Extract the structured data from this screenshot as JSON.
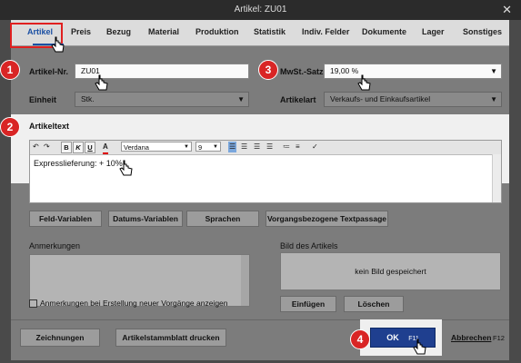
{
  "window": {
    "title": "Artikel: ZU01",
    "close_glyph": "✕"
  },
  "tabs": [
    "Artikel",
    "Preis",
    "Bezug",
    "Material",
    "Produktion",
    "Statistik",
    "Indiv. Felder",
    "Dokumente",
    "Lager",
    "Sonstiges"
  ],
  "form": {
    "artikel_nr_label": "Artikel-Nr.",
    "artikel_nr_value": "ZU01",
    "mwst_label": "MwSt.-Satz",
    "mwst_value": "19,00 %",
    "einheit_label": "Einheit",
    "einheit_value": "Stk.",
    "artikelart_label": "Artikelart",
    "artikelart_value": "Verkaufs- und Einkaufsartikel",
    "artikeltext_label": "Artikeltext",
    "artikeltext_value": "Expresslieferung: + 10%"
  },
  "editor_toolbar": {
    "bold": "B",
    "italic": "K",
    "underline": "U",
    "font": "Verdana",
    "size": "9"
  },
  "buttons": {
    "feld_variablen": "Feld-Variablen",
    "datums_variablen": "Datums-Variablen",
    "sprachen": "Sprachen",
    "textpassage": "Vorgangsbezogene Textpassage",
    "einfuegen": "Einfügen",
    "loeschen": "Löschen",
    "zeichnungen": "Zeichnungen",
    "stammblatt": "Artikelstammblatt drucken",
    "ok": "OK",
    "ok_key": "F11",
    "abbrechen": "Abbrechen",
    "abbrechen_key": "F12"
  },
  "notes": {
    "label": "Anmerkungen",
    "checkbox_label": "Anmerkungen bei Erstellung neuer Vorgänge anzeigen"
  },
  "image": {
    "label": "Bild des Artikels",
    "empty_text": "kein Bild gespeichert"
  },
  "badges": [
    "1",
    "2",
    "3",
    "4"
  ],
  "colors": {
    "accent": "#1a4fa3",
    "badge": "#d92525",
    "ok_button": "#1f3f8f"
  }
}
